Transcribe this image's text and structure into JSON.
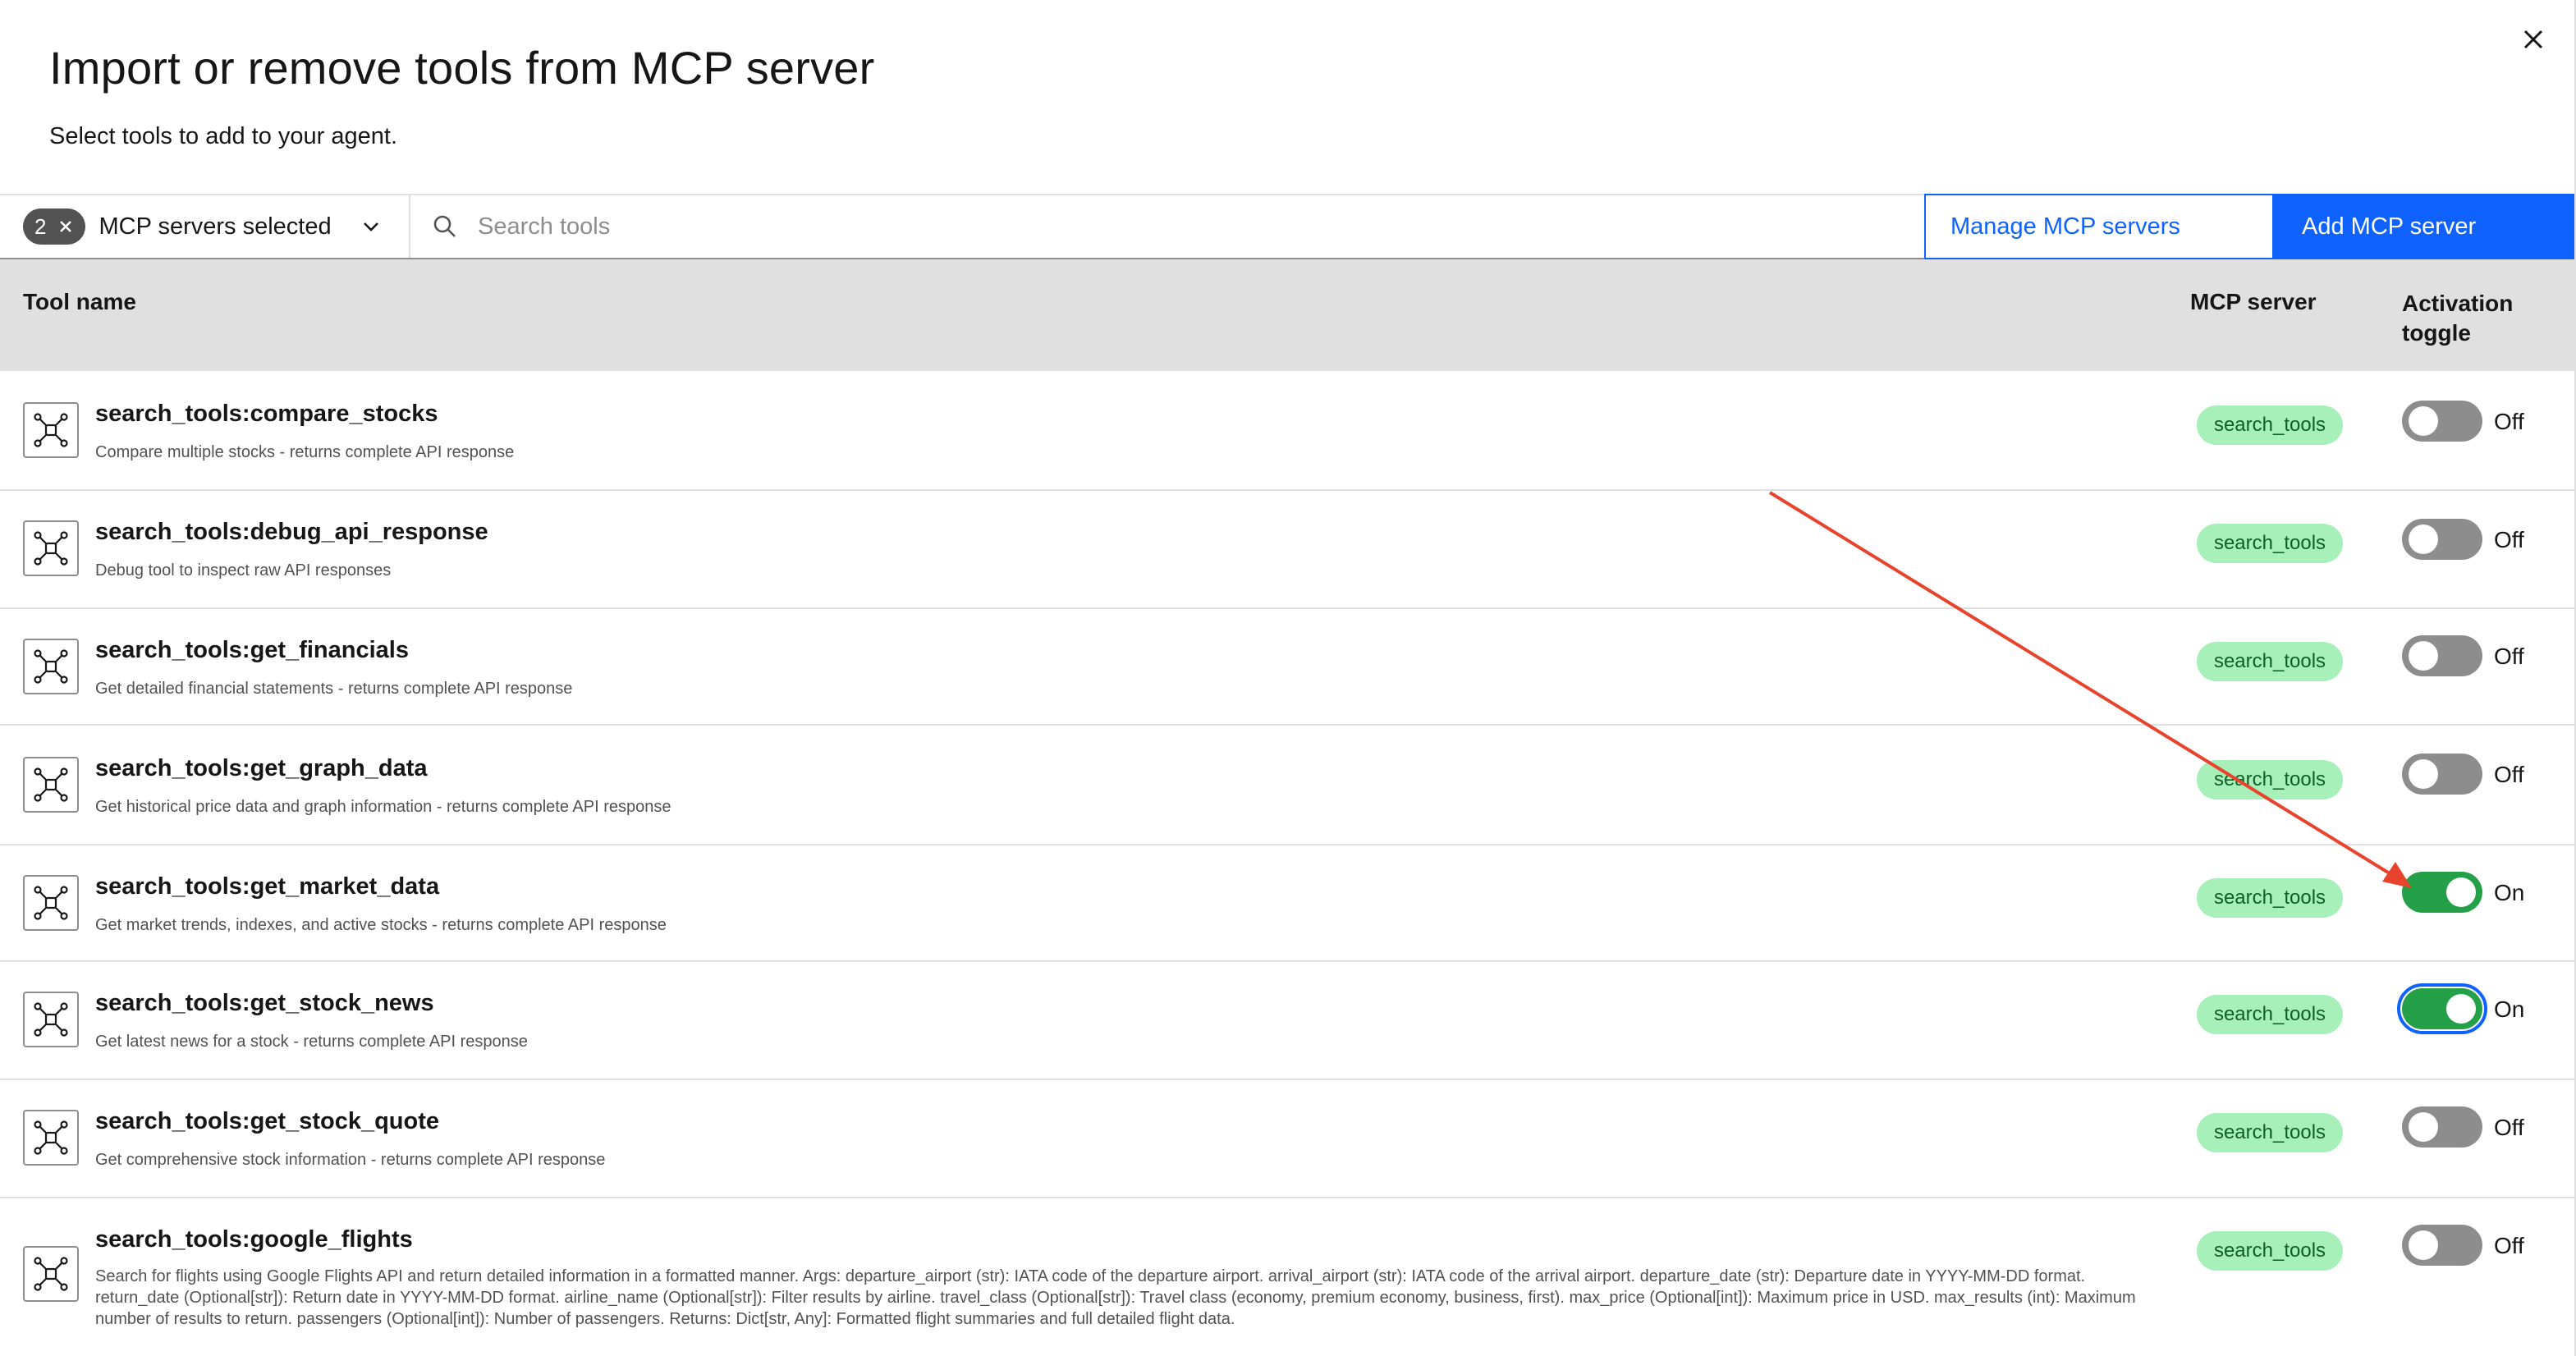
{
  "dialog": {
    "title": "Import or remove tools from MCP server",
    "subtitle": "Select tools to add to your agent.",
    "close_icon": "close-icon"
  },
  "toolbar": {
    "selected_count": "2",
    "servers_label": "MCP servers selected",
    "search_placeholder": "Search tools",
    "manage_label": "Manage MCP servers",
    "add_label": "Add MCP server"
  },
  "table": {
    "headers": {
      "name": "Tool name",
      "server": "MCP server",
      "toggle": "Activation toggle"
    },
    "rows": [
      {
        "name": "search_tools:compare_stocks",
        "description": "Compare multiple stocks - returns complete API response",
        "server": "search_tools",
        "active": false,
        "status": "Off"
      },
      {
        "name": "search_tools:debug_api_response",
        "description": "Debug tool to inspect raw API responses",
        "server": "search_tools",
        "active": false,
        "status": "Off"
      },
      {
        "name": "search_tools:get_financials",
        "description": "Get detailed financial statements - returns complete API response",
        "server": "search_tools",
        "active": false,
        "status": "Off"
      },
      {
        "name": "search_tools:get_graph_data",
        "description": "Get historical price data and graph information - returns complete API response",
        "server": "search_tools",
        "active": false,
        "status": "Off"
      },
      {
        "name": "search_tools:get_market_data",
        "description": "Get market trends, indexes, and active stocks - returns complete API response",
        "server": "search_tools",
        "active": true,
        "status": "On"
      },
      {
        "name": "search_tools:get_stock_news",
        "description": "Get latest news for a stock - returns complete API response",
        "server": "search_tools",
        "active": true,
        "status": "On"
      },
      {
        "name": "search_tools:get_stock_quote",
        "description": "Get comprehensive stock information - returns complete API response",
        "server": "search_tools",
        "active": false,
        "status": "Off"
      },
      {
        "name": "search_tools:google_flights",
        "description": "Search for flights using Google Flights API and return detailed information in a formatted manner. Args: departure_airport (str): IATA code of the departure airport. arrival_airport (str): IATA code of the arrival airport. departure_date (str): Departure date in YYYY-MM-DD format. return_date (Optional[str]): Return date in YYYY-MM-DD format. airline_name (Optional[str]): Filter results by airline. travel_class (Optional[str]): Travel class (economy, premium economy, business, first). max_price (Optional[int]): Maximum price in USD. max_results (int): Maximum number of results to return. passengers (Optional[int]): Number of passengers. Returns: Dict[str, Any]: Formatted flight summaries and full detailed flight data.",
        "server": "search_tools",
        "active": false,
        "status": "Off"
      }
    ]
  },
  "colors": {
    "primary": "#0f62fe",
    "toggle_on": "#24a148",
    "toggle_off": "#8d8d8d",
    "tag_bg": "#a7f0ba",
    "tag_text": "#0e6027",
    "annotation_arrow": "#e8432d"
  }
}
